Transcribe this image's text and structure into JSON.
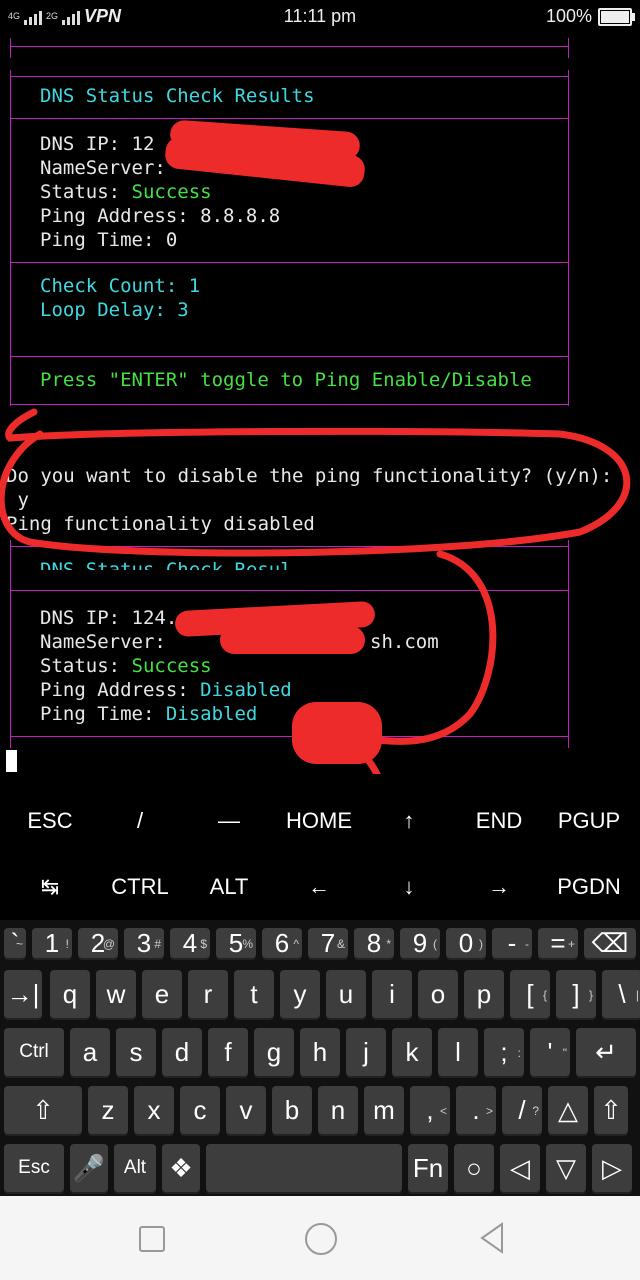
{
  "status_bar": {
    "network": "4G",
    "network2": "2G",
    "vpn": "VPN",
    "time": "11:11 pm",
    "battery": "100%"
  },
  "terminal": {
    "block1": {
      "title": "DNS Status Check Results",
      "dns_ip_label": "DNS IP: ",
      "dns_ip_value": "12",
      "nameserver_label": "NameServer: ",
      "status_label": "Status: ",
      "status_value": "Success",
      "ping_address": "Ping Address: 8.8.8.8",
      "ping_time": "Ping Time: 0",
      "check_count": "Check Count: 1",
      "loop_delay": "Loop Delay: 3",
      "press_enter": "Press \"ENTER\" toggle to Ping Enable/Disable"
    },
    "prompt_question": "Do you want to disable the ping functionality? (y/n):",
    "prompt_answer": " y",
    "prompt_result": "Ping functionality disabled",
    "block2": {
      "title_partial": "DNS Status Check Resul",
      "dns_ip_label": "DNS IP: ",
      "dns_ip_value": "124.",
      "nameserver_label": "NameServer: ",
      "nameserver_value_tail": "sh.com",
      "status_label": "Status: ",
      "status_value": "Success",
      "ping_address_label": "Ping Address: ",
      "ping_address_value": "Disabled",
      "ping_time_label": "Ping Time: ",
      "ping_time_value": "Disabled"
    }
  },
  "extra_keys": {
    "row1": [
      "ESC",
      "/",
      "—",
      "HOME",
      "↑",
      "END",
      "PGUP"
    ],
    "row2": [
      "↹",
      "CTRL",
      "ALT",
      "←",
      "↓",
      "→",
      "PGDN"
    ]
  },
  "keyboard": {
    "row_numbers": [
      {
        "k": "`",
        "s": "~"
      },
      {
        "k": "1",
        "s": "!"
      },
      {
        "k": "2",
        "s": "@"
      },
      {
        "k": "3",
        "s": "#"
      },
      {
        "k": "4",
        "s": "$"
      },
      {
        "k": "5",
        "s": "%"
      },
      {
        "k": "6",
        "s": "^"
      },
      {
        "k": "7",
        "s": "&"
      },
      {
        "k": "8",
        "s": "*"
      },
      {
        "k": "9",
        "s": "("
      },
      {
        "k": "0",
        "s": ")"
      },
      {
        "k": "-",
        "s": "-"
      },
      {
        "k": "=",
        "s": "+"
      },
      {
        "k": "⌫",
        "s": ""
      }
    ],
    "row_q": [
      "→|",
      "q",
      "w",
      "e",
      "r",
      "t",
      "y",
      "u",
      "i",
      "o",
      "p",
      "[",
      "]",
      "\\"
    ],
    "row_q_subs": [
      "",
      "",
      "",
      "",
      "",
      "",
      "",
      "",
      "",
      "",
      "",
      "{",
      "}",
      "|"
    ],
    "row_a": [
      "Ctrl",
      "a",
      "s",
      "d",
      "f",
      "g",
      "h",
      "j",
      "k",
      "l",
      ";",
      "'",
      "↵"
    ],
    "row_a_subs": [
      "",
      "",
      "",
      "",
      "",
      "",
      "",
      "",
      "",
      "",
      ":",
      "\"",
      ""
    ],
    "row_z": [
      "⇧",
      "z",
      "x",
      "c",
      "v",
      "b",
      "n",
      "m",
      ",",
      ".",
      "/",
      "△",
      "⇧"
    ],
    "row_z_subs": [
      "",
      "",
      "",
      "",
      "",
      "",
      "",
      "",
      "<",
      ">",
      "?",
      "",
      ""
    ],
    "row_bottom": [
      "Esc",
      "🎤",
      "Alt",
      "❖",
      "",
      "Fn",
      "○",
      "◁",
      "▽",
      "▷"
    ]
  },
  "colors": {
    "frame": "#c020c0",
    "cyan": "#3fd8e0",
    "green": "#44e044",
    "redaction": "#ee2b2b"
  }
}
